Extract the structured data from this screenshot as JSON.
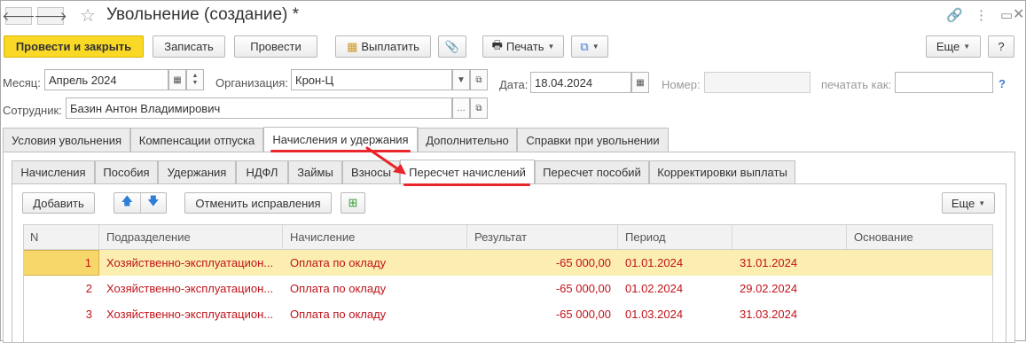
{
  "window": {
    "title": "Увольнение (создание) *",
    "back_icon": "arrow-left",
    "forward_icon": "arrow-right"
  },
  "toolbar": {
    "post_close": "Провести и закрыть",
    "save": "Записать",
    "post": "Провести",
    "pay": "Выплатить",
    "print": "Печать",
    "more": "Еще",
    "help": "?"
  },
  "form": {
    "month_label": "Месяц:",
    "month_value": "Апрель 2024",
    "org_label": "Организация:",
    "org_value": "Крон-Ц",
    "date_label": "Дата:",
    "date_value": "18.04.2024",
    "number_label": "Номер:",
    "number_value": "",
    "print_as_label": "печатать как:",
    "print_as_value": "",
    "help_q": "?",
    "employee_label": "Сотрудник:",
    "employee_value": "Базин Антон Владимирович"
  },
  "tabs": [
    "Условия увольнения",
    "Компенсации отпуска",
    "Начисления и удержания",
    "Дополнительно",
    "Справки при увольнении"
  ],
  "subtabs": [
    "Начисления",
    "Пособия",
    "Удержания",
    "НДФЛ",
    "Займы",
    "Взносы",
    "Пересчет начислений",
    "Пересчет пособий",
    "Корректировки выплаты"
  ],
  "panel_toolbar": {
    "add": "Добавить",
    "cancel_fix": "Отменить исправления",
    "more": "Еще"
  },
  "table": {
    "columns": [
      "N",
      "Подразделение",
      "Начисление",
      "Результат",
      "Период",
      "",
      "Основание"
    ],
    "rows": [
      {
        "n": "1",
        "division": "Хозяйственно-эксплуатацион...",
        "accrual": "Оплата по окладу",
        "result": "-65 000,00",
        "from": "01.01.2024",
        "to": "31.01.2024",
        "basis": ""
      },
      {
        "n": "2",
        "division": "Хозяйственно-эксплуатацион...",
        "accrual": "Оплата по окладу",
        "result": "-65 000,00",
        "from": "01.02.2024",
        "to": "29.02.2024",
        "basis": ""
      },
      {
        "n": "3",
        "division": "Хозяйственно-эксплуатацион...",
        "accrual": "Оплата по окладу",
        "result": "-65 000,00",
        "from": "01.03.2024",
        "to": "31.03.2024",
        "basis": ""
      }
    ]
  },
  "colors": {
    "primary": "#fad826",
    "row_text": "#c0131b",
    "selected_row": "#fbeeb0",
    "annotation": "#e8262b"
  }
}
